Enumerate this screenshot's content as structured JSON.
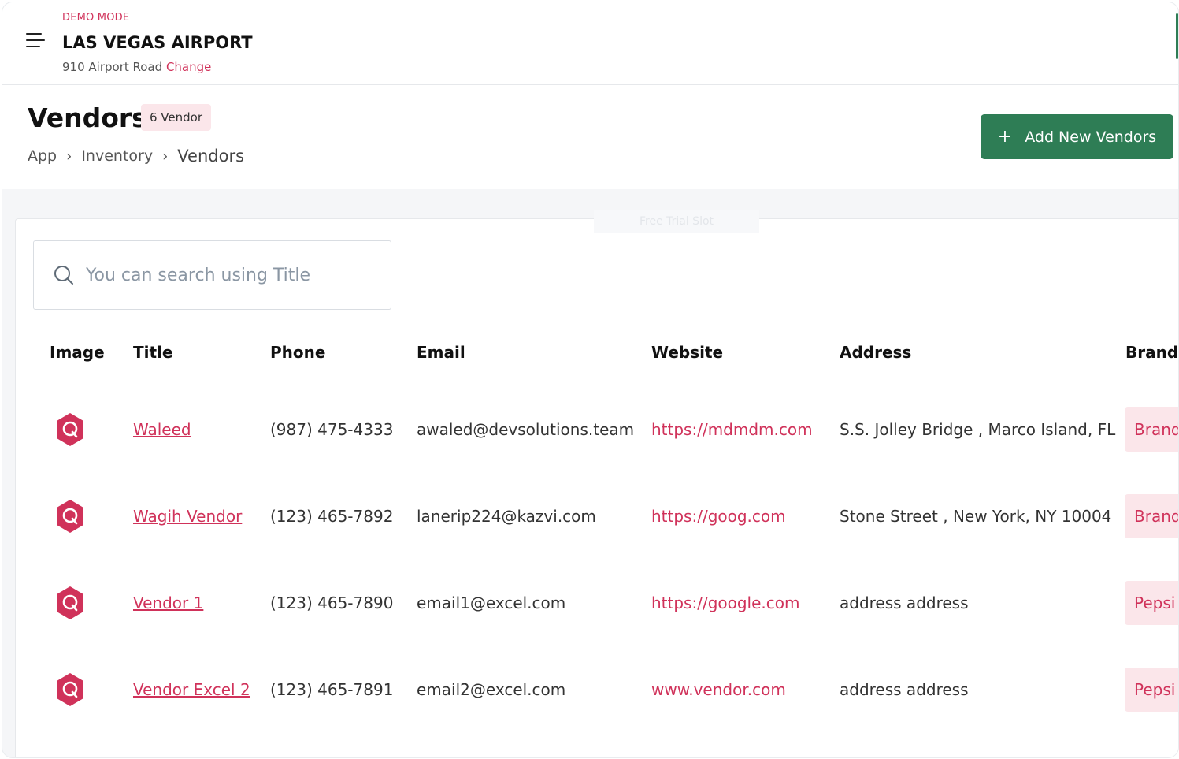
{
  "header": {
    "demo_label": "DEMO MODE",
    "store_name": "LAS VEGAS AIRPORT",
    "store_address": "910 Airport Road",
    "change_label": "Change"
  },
  "page": {
    "title": "Vendors",
    "count_badge": "6 Vendor",
    "breadcrumb": [
      "App",
      "Inventory",
      "Vendors"
    ],
    "add_button_label": "Add New Vendors",
    "faint_tab_label": "Free Trial Slot"
  },
  "search": {
    "placeholder": "You can search using Title",
    "value": ""
  },
  "table": {
    "columns": [
      "Image",
      "Title",
      "Phone",
      "Email",
      "Website",
      "Address",
      "Brands"
    ],
    "rows": [
      {
        "title": "Waleed",
        "phone": "(987) 475-4333",
        "email": "awaled@devsolutions.team",
        "website": "https://mdmdm.com",
        "address": "S.S. Jolley Bridge , Marco Island, FL",
        "brand": "Brand"
      },
      {
        "title": "Wagih Vendor",
        "phone": "(123) 465-7892",
        "email": "lanerip224@kazvi.com",
        "website": "https://goog.com",
        "address": "Stone Street , New York, NY 10004",
        "brand": "Brand"
      },
      {
        "title": "Vendor 1",
        "phone": "(123) 465-7890",
        "email": "email1@excel.com",
        "website": "https://google.com",
        "address": "address address",
        "brand": "Pepsi"
      },
      {
        "title": "Vendor Excel 2",
        "phone": "(123) 465-7891",
        "email": "email2@excel.com",
        "website": "www.vendor.com",
        "address": "address address",
        "brand": "Pepsi"
      }
    ],
    "avatar_icon": "vendor-logo-hexagon-q-icon"
  },
  "colors": {
    "accent": "#d0325a",
    "primary_button": "#2e7d55",
    "badge_bg": "#fbe6ea",
    "page_bg": "#f5f6f8"
  }
}
